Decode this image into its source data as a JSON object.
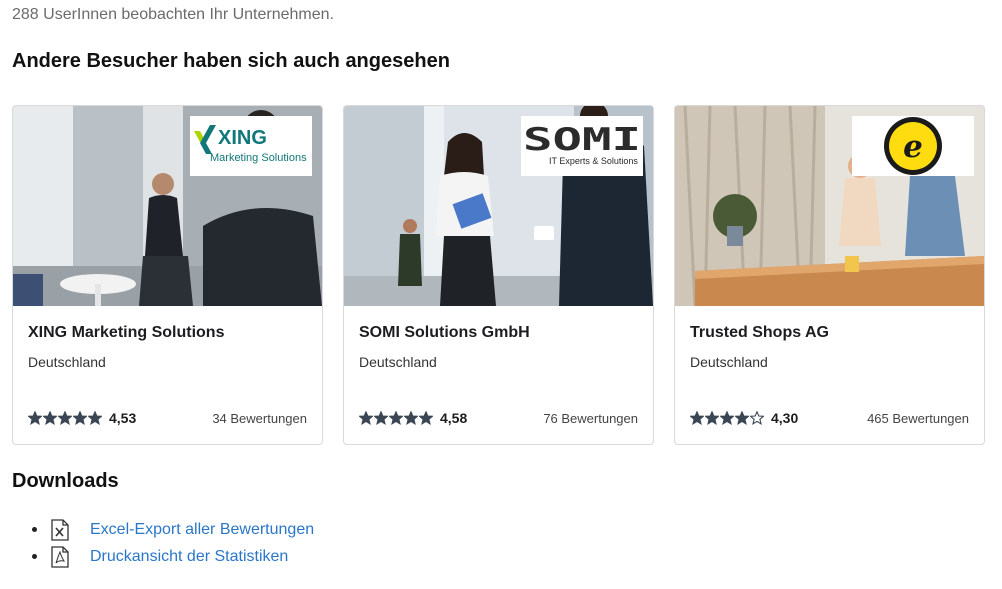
{
  "followers_text": "288 UserInnen beobachten Ihr Unternehmen.",
  "others_heading": "Andere Besucher haben sich auch angesehen",
  "cards": [
    {
      "name": "XING Marketing Solutions",
      "country": "Deutschland",
      "score": "4,53",
      "reviews": "34 Bewertungen",
      "stars": 5,
      "logo": {
        "word": "XING",
        "sub": "Marketing Solutions",
        "mark": "xing-x-icon",
        "color": "#127779"
      }
    },
    {
      "name": "SOMI Solutions GmbH",
      "country": "Deutschland",
      "score": "4,58",
      "reviews": "76 Bewertungen",
      "stars": 5,
      "logo": {
        "word": "SOMI",
        "sub": "IT Experts & Solutions"
      }
    },
    {
      "name": "Trusted Shops AG",
      "country": "Deutschland",
      "score": "4,30",
      "reviews": "465 Bewertungen",
      "stars": 4,
      "logo": {
        "letter": "e",
        "color": "#ffdc0f"
      }
    }
  ],
  "downloads_heading": "Downloads",
  "downloads": [
    {
      "label": "Excel-Export aller Bewertungen",
      "icon": "excel-file-icon"
    },
    {
      "label": "Druckansicht der Statistiken",
      "icon": "pdf-file-icon"
    }
  ],
  "colors": {
    "link": "#2a77c9",
    "star": "#3b4654",
    "xing": "#127779",
    "trusted_yellow": "#ffdc0f"
  }
}
